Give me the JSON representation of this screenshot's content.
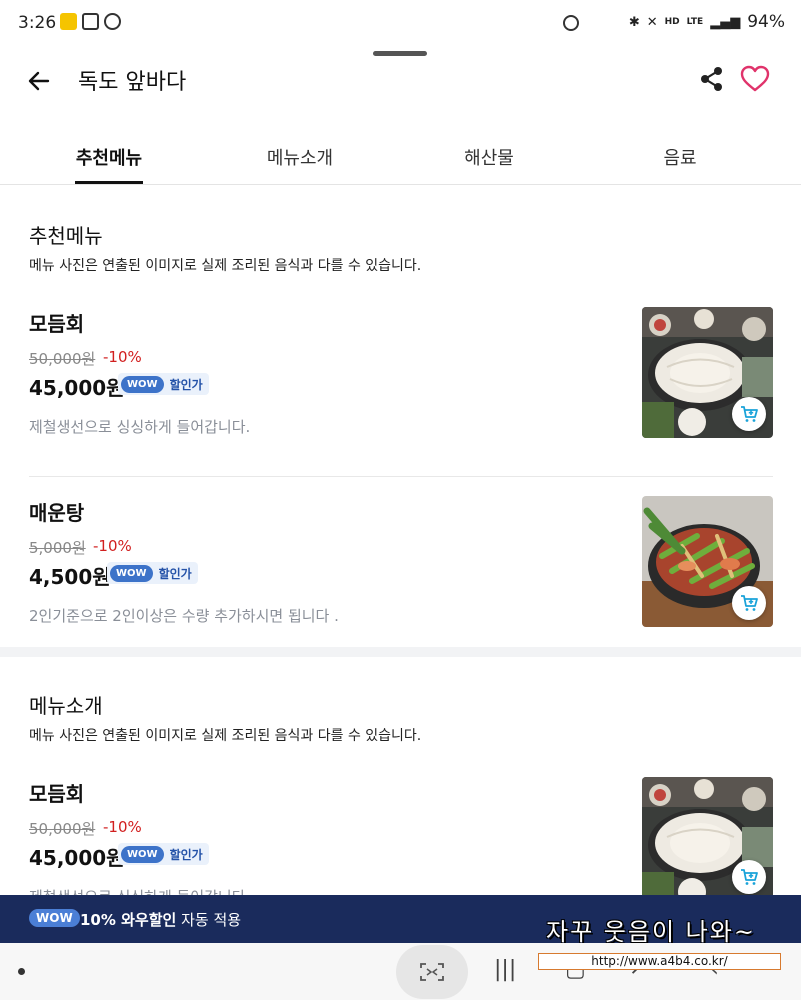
{
  "status_bar": {
    "time": "3:26",
    "network": "LTE",
    "hd_voice": "HD",
    "battery": "94%"
  },
  "header": {
    "title": "독도 앞바다",
    "back_icon": "arrow-left-icon",
    "share_icon": "share-icon",
    "favorite_icon": "heart-outline-icon"
  },
  "tabs": [
    {
      "label": "추천메뉴",
      "active": true
    },
    {
      "label": "메뉴소개",
      "active": false
    },
    {
      "label": "해산물",
      "active": false
    },
    {
      "label": "음료",
      "active": false
    }
  ],
  "sections": [
    {
      "title": "추천메뉴",
      "note": "메뉴 사진은 연출된 이미지로 실제 조리된 음식과 다를 수 있습니다.",
      "items": [
        {
          "name": "모듬회",
          "original_price": "50,000원",
          "discount": "-10%",
          "price": "45,000원",
          "wow_badge": "WOW",
          "wow_label": "할인가",
          "description": "제철생선으로 싱싱하게 들어갑니다.",
          "photo": "sashimi-platter-photo"
        },
        {
          "name": "매운탕",
          "original_price": "5,000원",
          "discount": "-10%",
          "price": "4,500원",
          "wow_badge": "WOW",
          "wow_label": "할인가",
          "description": "2인기준으로 2인이상은 수량 추가하시면 됩니다 .",
          "photo": "spicy-fish-stew-photo"
        }
      ]
    },
    {
      "title": "메뉴소개",
      "note": "메뉴 사진은 연출된 이미지로 실제 조리된 음식과 다를 수 있습니다.",
      "items": [
        {
          "name": "모듬회",
          "original_price": "50,000원",
          "discount": "-10%",
          "price": "45,000원",
          "wow_badge": "WOW",
          "wow_label": "할인가",
          "description": "제철생선으로 싱싱하게 들어갑니다.",
          "photo": "sashimi-platter-photo"
        }
      ]
    }
  ],
  "promo": {
    "badge": "WOW",
    "bold_text": "10% 와우할인",
    "text": " 자동 적용"
  },
  "overlay": {
    "watermark": "자꾸 웃음이 나와~",
    "url": "http://www.a4b4.co.kr/"
  },
  "colors": {
    "price_discount": "#d11f1f",
    "wow_blue": "#3d73c9",
    "promo_bar": "#1a2b5c",
    "favorite": "#e0336b"
  }
}
